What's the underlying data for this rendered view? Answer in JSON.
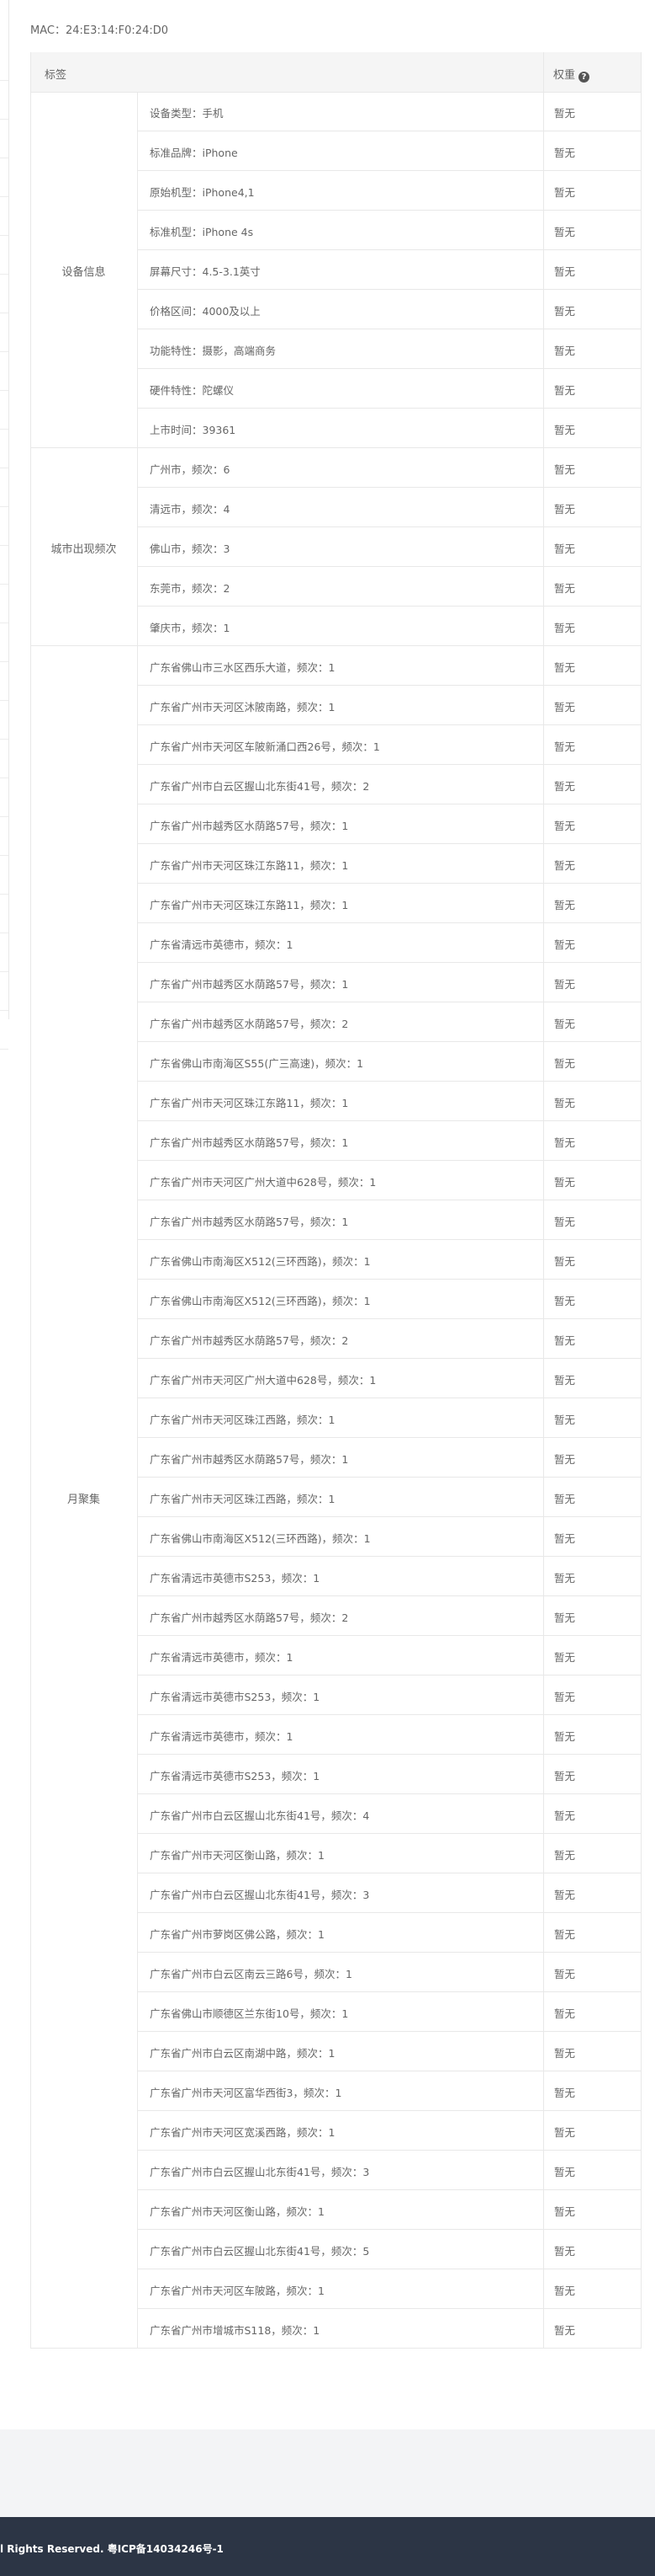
{
  "mac_line": "MAC：24:E3:14:F0:24:D0",
  "table": {
    "header_label": "标签",
    "header_weight": "权重",
    "groups": [
      {
        "label": "设备信息",
        "rows": [
          {
            "text": "设备类型：手机",
            "weight": "暂无"
          },
          {
            "text": "标准品牌：iPhone",
            "weight": "暂无"
          },
          {
            "text": "原始机型：iPhone4,1",
            "weight": "暂无"
          },
          {
            "text": "标准机型：iPhone 4s",
            "weight": "暂无"
          },
          {
            "text": "屏幕尺寸：4.5-3.1英寸",
            "weight": "暂无"
          },
          {
            "text": "价格区间：4000及以上",
            "weight": "暂无"
          },
          {
            "text": "功能特性：摄影，高端商务",
            "weight": "暂无"
          },
          {
            "text": "硬件特性：陀螺仪",
            "weight": "暂无"
          },
          {
            "text": "上市时间：39361",
            "weight": "暂无"
          }
        ]
      },
      {
        "label": "城市出现频次",
        "rows": [
          {
            "text": "广州市，频次：6",
            "weight": "暂无"
          },
          {
            "text": "清远市，频次：4",
            "weight": "暂无"
          },
          {
            "text": "佛山市，频次：3",
            "weight": "暂无"
          },
          {
            "text": "东莞市，频次：2",
            "weight": "暂无"
          },
          {
            "text": "肇庆市，频次：1",
            "weight": "暂无"
          }
        ]
      },
      {
        "label": "月聚集",
        "rows": [
          {
            "text": "广东省佛山市三水区西乐大道，频次：1",
            "weight": "暂无"
          },
          {
            "text": "广东省广州市天河区沐陂南路，频次：1",
            "weight": "暂无"
          },
          {
            "text": "广东省广州市天河区车陂新涌口西26号，频次：1",
            "weight": "暂无"
          },
          {
            "text": "广东省广州市白云区握山北东街41号，频次：2",
            "weight": "暂无"
          },
          {
            "text": "广东省广州市越秀区水荫路57号，频次：1",
            "weight": "暂无"
          },
          {
            "text": "广东省广州市天河区珠江东路11，频次：1",
            "weight": "暂无"
          },
          {
            "text": "广东省广州市天河区珠江东路11，频次：1",
            "weight": "暂无"
          },
          {
            "text": "广东省清远市英德市，频次：1",
            "weight": "暂无"
          },
          {
            "text": "广东省广州市越秀区水荫路57号，频次：1",
            "weight": "暂无"
          },
          {
            "text": "广东省广州市越秀区水荫路57号，频次：2",
            "weight": "暂无"
          },
          {
            "text": "广东省佛山市南海区S55(广三高速)，频次：1",
            "weight": "暂无"
          },
          {
            "text": "广东省广州市天河区珠江东路11，频次：1",
            "weight": "暂无"
          },
          {
            "text": "广东省广州市越秀区水荫路57号，频次：1",
            "weight": "暂无"
          },
          {
            "text": "广东省广州市天河区广州大道中628号，频次：1",
            "weight": "暂无"
          },
          {
            "text": "广东省广州市越秀区水荫路57号，频次：1",
            "weight": "暂无"
          },
          {
            "text": "广东省佛山市南海区X512(三环西路)，频次：1",
            "weight": "暂无"
          },
          {
            "text": "广东省佛山市南海区X512(三环西路)，频次：1",
            "weight": "暂无"
          },
          {
            "text": "广东省广州市越秀区水荫路57号，频次：2",
            "weight": "暂无"
          },
          {
            "text": "广东省广州市天河区广州大道中628号，频次：1",
            "weight": "暂无"
          },
          {
            "text": "广东省广州市天河区珠江西路，频次：1",
            "weight": "暂无"
          },
          {
            "text": "广东省广州市越秀区水荫路57号，频次：1",
            "weight": "暂无"
          },
          {
            "text": "广东省广州市天河区珠江西路，频次：1",
            "weight": "暂无"
          },
          {
            "text": "广东省佛山市南海区X512(三环西路)，频次：1",
            "weight": "暂无"
          },
          {
            "text": "广东省清远市英德市S253，频次：1",
            "weight": "暂无"
          },
          {
            "text": "广东省广州市越秀区水荫路57号，频次：2",
            "weight": "暂无"
          },
          {
            "text": "广东省清远市英德市，频次：1",
            "weight": "暂无"
          },
          {
            "text": "广东省清远市英德市S253，频次：1",
            "weight": "暂无"
          },
          {
            "text": "广东省清远市英德市，频次：1",
            "weight": "暂无"
          },
          {
            "text": "广东省清远市英德市S253，频次：1",
            "weight": "暂无"
          },
          {
            "text": "广东省广州市白云区握山北东街41号，频次：4",
            "weight": "暂无"
          },
          {
            "text": "广东省广州市天河区衡山路，频次：1",
            "weight": "暂无"
          },
          {
            "text": "广东省广州市白云区握山北东街41号，频次：3",
            "weight": "暂无"
          },
          {
            "text": "广东省广州市萝岗区佛公路，频次：1",
            "weight": "暂无"
          },
          {
            "text": "广东省广州市白云区南云三路6号，频次：1",
            "weight": "暂无"
          },
          {
            "text": "广东省佛山市顺德区兰东街10号，频次：1",
            "weight": "暂无"
          },
          {
            "text": "广东省广州市白云区南湖中路，频次：1",
            "weight": "暂无"
          },
          {
            "text": "广东省广州市天河区富华西街3，频次：1",
            "weight": "暂无"
          },
          {
            "text": "广东省广州市天河区宽溪西路，频次：1",
            "weight": "暂无"
          },
          {
            "text": "广东省广州市白云区握山北东街41号，频次：3",
            "weight": "暂无"
          },
          {
            "text": "广东省广州市天河区衡山路，频次：1",
            "weight": "暂无"
          },
          {
            "text": "广东省广州市白云区握山北东街41号，频次：5",
            "weight": "暂无"
          },
          {
            "text": "广东省广州市天河区车陂路，频次：1",
            "weight": "暂无"
          },
          {
            "text": "广东省广州市增城市S118，频次：1",
            "weight": "暂无"
          }
        ]
      }
    ]
  },
  "footer": {
    "text": "l Rights Reserved. 粤ICP备14034246号-1"
  },
  "colors": {
    "border": "#e8e8e8",
    "header_bg": "#f5f5f5",
    "footer_bg": "#2c3545",
    "bottom_band_bg": "#f3f4f6",
    "text": "#666666"
  }
}
